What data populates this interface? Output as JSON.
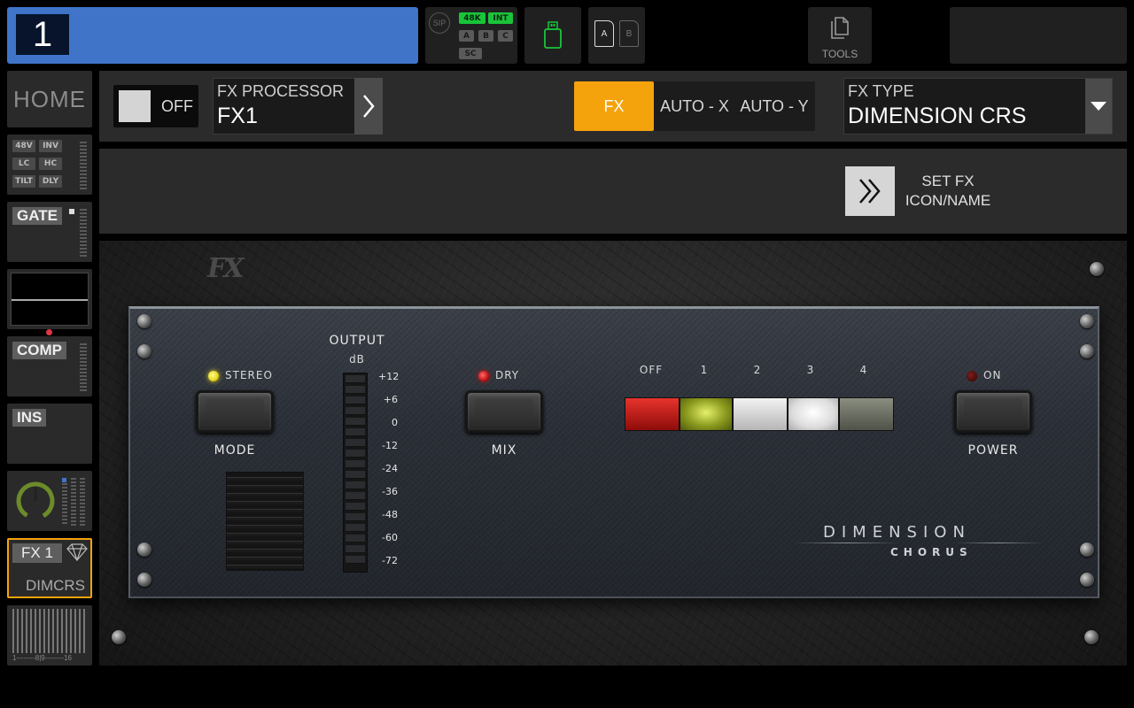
{
  "top_bar": {
    "channel_number": "1",
    "status": {
      "sip": "SIP",
      "chip_48k": "48K",
      "chip_int": "INT",
      "chip_a": "A",
      "chip_b": "B",
      "chip_c": "C",
      "chip_sc": "SC"
    },
    "card_a": "A",
    "card_b": "B",
    "tools_label": "TOOLS"
  },
  "sidebar": {
    "home": "HOME",
    "input_chips": [
      "48V",
      "INV",
      "LC",
      "HC",
      "TILT",
      "DLY"
    ],
    "gate_label": "GATE",
    "comp_label": "COMP",
    "ins_label": "INS",
    "fx_slot_label": "FX 1",
    "fx_slot_name": "DIMCRS",
    "routing_label": "1--------8|9--------16"
  },
  "fx_header": {
    "off_label": "OFF",
    "processor_caption": "FX PROCESSOR",
    "processor_value": "FX1",
    "tab_fx": "FX",
    "tab_auto_x": "AUTO - X",
    "tab_auto_y": "AUTO - Y",
    "type_caption": "FX TYPE",
    "type_value": "DIMENSION CRS",
    "set_fx_line1": "SET FX",
    "set_fx_line2": "ICON/NAME"
  },
  "plugin": {
    "logo": "FX",
    "stereo_label": "STEREO",
    "mode_label": "MODE",
    "output_label": "OUTPUT",
    "output_unit": "dB",
    "meter_ticks": [
      "+12",
      "+6",
      "0",
      "-12",
      "-24",
      "-36",
      "-48",
      "-60",
      "-72"
    ],
    "dry_label": "DRY",
    "mix_label": "MIX",
    "selector_labels": [
      "OFF",
      "1",
      "2",
      "3",
      "4"
    ],
    "power_on_label": "ON",
    "power_label": "POWER",
    "brand_name": "DIMENSION",
    "brand_sub": "CHORUS",
    "colors": {
      "selector_off": "#c21a16",
      "selector_1": "#8b9a1e",
      "selector_2": "#d8d8d8",
      "selector_3": "#eaeaea",
      "selector_4": "#6c6f62"
    }
  },
  "colors": {
    "channel_blue": "#3f74c9",
    "accent_orange": "#f4a30c",
    "status_green": "#19c43a"
  }
}
